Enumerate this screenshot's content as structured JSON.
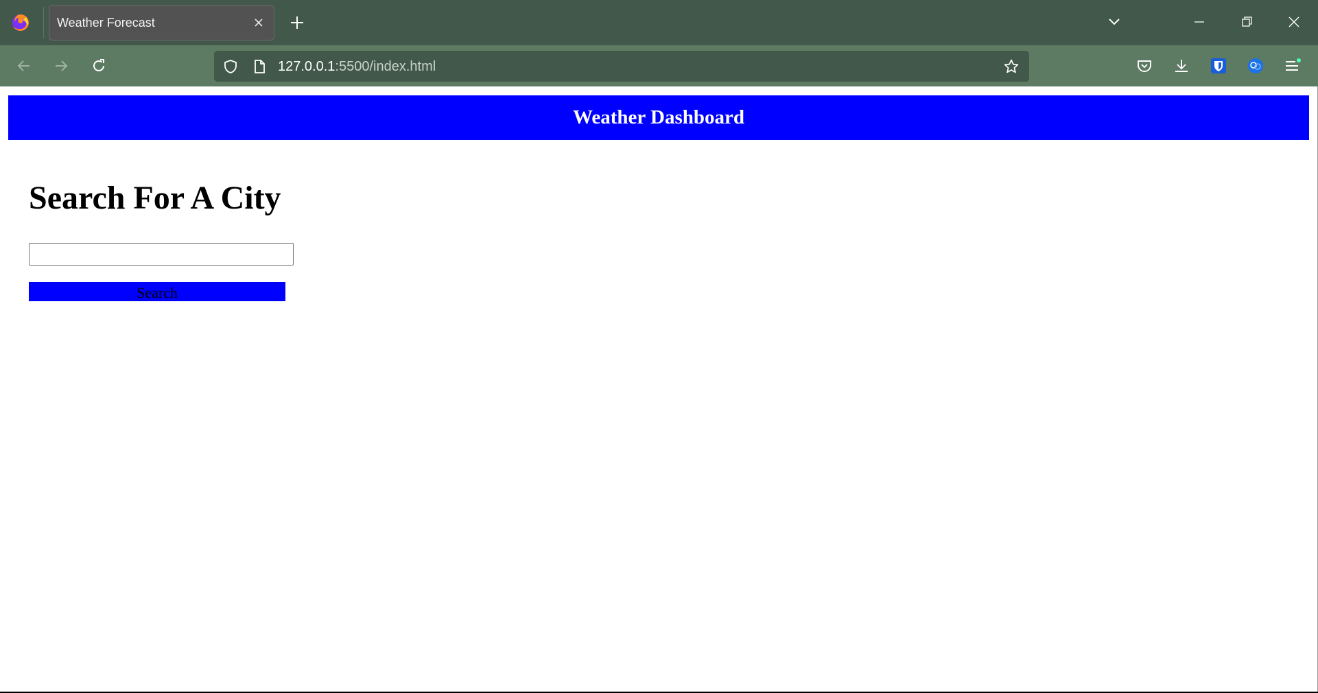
{
  "browser": {
    "tab_title": "Weather Forecast",
    "url_host": "127.0.0.1",
    "url_path": ":5500/index.html"
  },
  "page": {
    "header_title": "Weather Dashboard",
    "search_heading": "Search For A City",
    "search_input_value": "",
    "search_button_label": "Search"
  },
  "colors": {
    "header_bg": "#0000ff",
    "button_bg": "#0000ff",
    "chrome_tabbar": "#41584a",
    "chrome_navbar": "#5d7a63"
  },
  "icons": {
    "browser": "firefox-logo",
    "tab_close": "close-icon",
    "new_tab": "plus-icon",
    "tab_list": "chevron-down-icon",
    "minimize": "minimize-icon",
    "restore": "restore-icon",
    "close_window": "close-icon",
    "back": "back-arrow-icon",
    "forward": "forward-arrow-icon",
    "reload": "reload-icon",
    "tracking": "shield-icon",
    "page_info": "document-icon",
    "bookmark": "star-icon",
    "pocket": "pocket-icon",
    "downloads": "download-icon",
    "bitwarden": "bitwarden-shield-icon",
    "translate": "translate-icon",
    "menu": "hamburger-menu-icon"
  }
}
